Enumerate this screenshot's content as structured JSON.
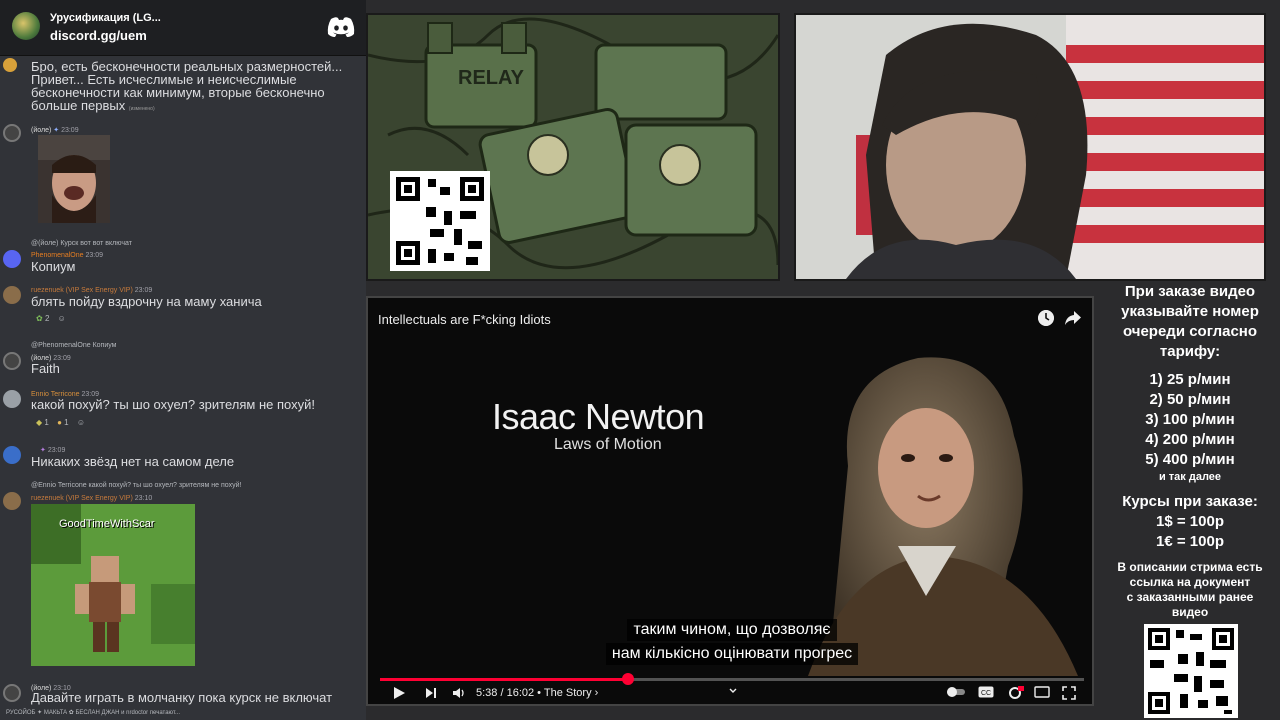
{
  "server": {
    "name": "Урусификация (LG...",
    "link": "discord.gg/uem"
  },
  "chat": {
    "msg0": {
      "line1": "Бро, есть бесконечности реальных размерностей...",
      "line2": "Привет... Есть исчеслимые и неисчеслимые",
      "line3": "бесконечности как минимум, вторые бесконечно",
      "line4": "больше первых",
      "edited": "(изменено)"
    },
    "msg1": {
      "name": "(йоле)",
      "time": "23:09"
    },
    "msg2": {
      "reply": "@(йоле) Курск вот вот включат",
      "name": "PhenomenalOne",
      "time": "23:09",
      "text": "Копиум"
    },
    "msg3": {
      "name": "ruezenuek (VIP Sex Energy VIP)",
      "time": "23:09",
      "text": "блять пойду вздрочну на маму ханича",
      "react_count": "2"
    },
    "msg4": {
      "reply": "@PhenomenalOne Копиум",
      "name": "(йоле)",
      "time": "23:09",
      "text": "Faith"
    },
    "msg5": {
      "name": "Ennio Terricone",
      "time": "23:09",
      "text": "какой похуй? ты шо охуел? зрителям не похуй!",
      "react_count1": "1",
      "react_count2": "1"
    },
    "msg6": {
      "time": "23:09",
      "text": "Никаких звёзд нет на самом деле"
    },
    "msg7": {
      "reply": "@Ennio Terricone какой похуй? ты шо охуел? зрителям не похуй!",
      "name": "ruezenuek (VIP Sex Energy VIP)",
      "time": "23:10",
      "image_caption": "GoodTimeWithScar"
    },
    "msg8": {
      "name": "(йоле)",
      "time": "23:10",
      "text": "Давайте играть в молчанку пока курск не включат"
    },
    "typing": "РУСОЙОБ ✦ МАКЬТА ✿ БЕСЛАН ДЖАН и nrdoctor печатают..."
  },
  "relay_image": {
    "sign": "RELAY"
  },
  "player": {
    "title": "Intellectuals are F*cking Idiots",
    "name_big": "Isaac Newton",
    "name_sub": "Laws of Motion",
    "sub_line1": "таким чином, що дозволяє",
    "sub_line2": "нам кількісно оцінювати прогрес",
    "time": "5:38 / 16:02",
    "chapter": "• The Story ›",
    "progress": 0.352,
    "accent": "#ff0033"
  },
  "info": {
    "h1": "При заказе видео",
    "h2": "указывайте номер",
    "h3": "очереди согласно",
    "h4": "тарифу:",
    "t1": "1) 25 р/мин",
    "t2": "2) 50 р/мин",
    "t3": "3) 100 р/мин",
    "t4": "4) 200 р/мин",
    "t5": "5) 400 р/мин",
    "etc": "и так далее",
    "c1": "Курсы при заказе:",
    "c2": "1$ = 100р",
    "c3": "1€ = 100р",
    "d1": "В описании стрима есть",
    "d2": "ссылка на документ",
    "d3": "с заказанными ранее",
    "d4": "видео"
  }
}
